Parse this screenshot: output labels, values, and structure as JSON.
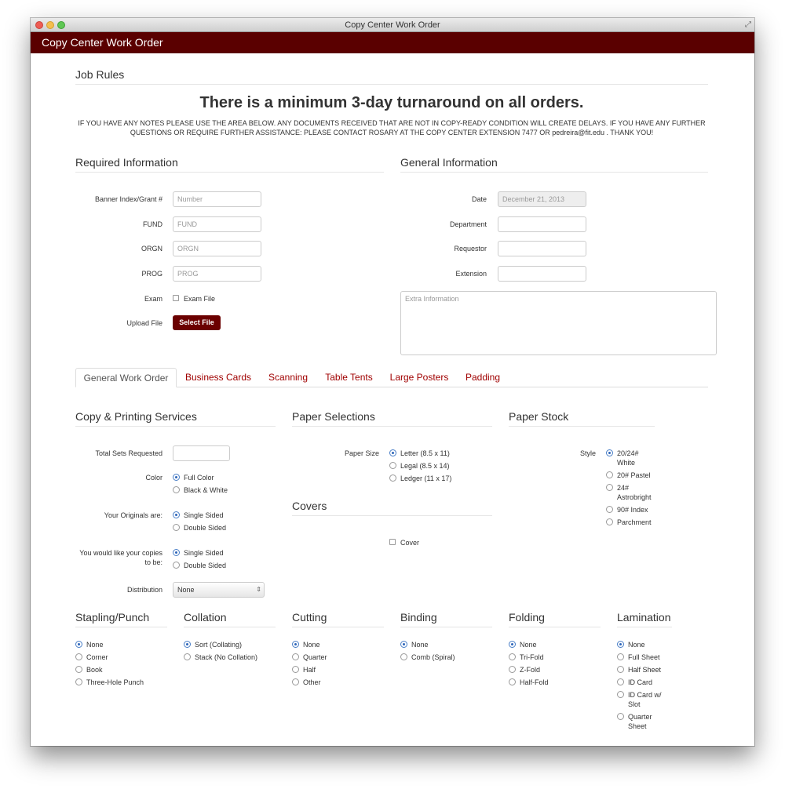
{
  "window": {
    "title": "Copy Center Work Order"
  },
  "appbar": {
    "brand": "Copy Center Work Order"
  },
  "job_rules": {
    "title": "Job Rules",
    "headline": "There is a minimum 3-day turnaround on all orders.",
    "notice_line1": "IF YOU HAVE ANY NOTES PLEASE USE THE AREA BELOW. ANY DOCUMENTS RECEIVED THAT ARE NOT IN COPY-READY CONDITION WILL CREATE DELAYS. IF YOU HAVE ANY FURTHER",
    "notice_line2": "QUESTIONS OR REQUIRE FURTHER ASSISTANCE: PLEASE CONTACT ROSARY AT THE COPY CENTER EXTENSION 7477 OR pedreira@fit.edu . THANK YOU!"
  },
  "required": {
    "title": "Required Information",
    "banner_label": "Banner Index/Grant #",
    "banner_placeholder": "Number",
    "fund_label": "FUND",
    "fund_placeholder": "FUND",
    "orgn_label": "ORGN",
    "orgn_placeholder": "ORGN",
    "prog_label": "PROG",
    "prog_placeholder": "PROG",
    "exam_label": "Exam",
    "exam_option": "Exam File",
    "upload_label": "Upload File",
    "upload_button": "Select File"
  },
  "general": {
    "title": "General Information",
    "date_label": "Date",
    "date_value": "December 21, 2013",
    "department_label": "Department",
    "requestor_label": "Requestor",
    "extension_label": "Extension",
    "extra_placeholder": "Extra Information"
  },
  "tabs": [
    "General Work Order",
    "Business Cards",
    "Scanning",
    "Table Tents",
    "Large Posters",
    "Padding"
  ],
  "copy_printing": {
    "title": "Copy & Printing Services",
    "total_sets_label": "Total Sets Requested",
    "color_label": "Color",
    "color_options": [
      "Full Color",
      "Black & White"
    ],
    "originals_label": "Your Originals are:",
    "originals_options": [
      "Single Sided",
      "Double Sided"
    ],
    "copies_label_line1": "You would like your copies",
    "copies_label_line2": "to be:",
    "copies_options": [
      "Single Sided",
      "Double Sided"
    ],
    "distribution_label": "Distribution",
    "distribution_value": "None"
  },
  "paper_selections": {
    "title": "Paper Selections",
    "size_label": "Paper Size",
    "size_options": [
      "Letter (8.5 x 11)",
      "Legal (8.5 x 14)",
      "Ledger (11 x 17)"
    ]
  },
  "covers": {
    "title": "Covers",
    "option": "Cover"
  },
  "paper_stock": {
    "title": "Paper Stock",
    "style_label": "Style",
    "options": [
      [
        "20/24#",
        "White"
      ],
      [
        "20# Pastel"
      ],
      [
        "24#",
        "Astrobright"
      ],
      [
        "90# Index"
      ],
      [
        "Parchment"
      ]
    ]
  },
  "stapling": {
    "title": "Stapling/Punch",
    "options": [
      "None",
      "Corner",
      "Book",
      "Three-Hole Punch"
    ]
  },
  "collation": {
    "title": "Collation",
    "options": [
      "Sort (Collating)",
      "Stack (No Collation)"
    ]
  },
  "cutting": {
    "title": "Cutting",
    "options": [
      "None",
      "Quarter",
      "Half",
      "Other"
    ]
  },
  "binding": {
    "title": "Binding",
    "options": [
      "None",
      "Comb (Spiral)"
    ]
  },
  "folding": {
    "title": "Folding",
    "options": [
      "None",
      "Tri-Fold",
      "Z-Fold",
      "Half-Fold"
    ]
  },
  "lamination": {
    "title": "Lamination",
    "options": [
      [
        "None"
      ],
      [
        "Full Sheet"
      ],
      [
        "Half Sheet"
      ],
      [
        "ID Card"
      ],
      [
        "ID Card w/",
        "Slot"
      ],
      [
        "Quarter",
        "Sheet"
      ]
    ]
  }
}
